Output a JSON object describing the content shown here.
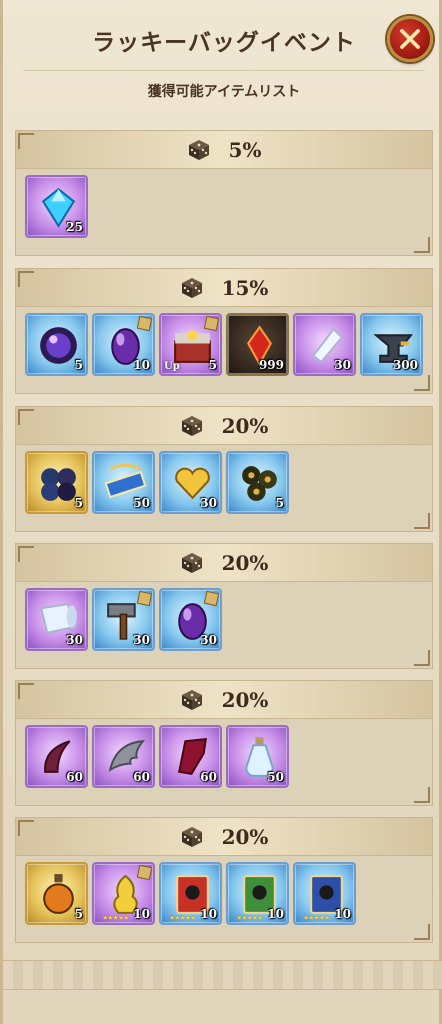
{
  "header": {
    "title": "ラッキーバッグイベント",
    "subtitle": "獲得可能アイテムリスト"
  },
  "sections": [
    {
      "rate": "5%",
      "items": [
        {
          "icon": "blue-gem-icon",
          "rarity": "purple",
          "qty": "25"
        }
      ]
    },
    {
      "rate": "15%",
      "items": [
        {
          "icon": "dark-orb-icon",
          "rarity": "blue",
          "qty": "5"
        },
        {
          "icon": "purple-egg-icon",
          "rarity": "blue",
          "qty": "10",
          "badge": true
        },
        {
          "icon": "treasure-chest-icon",
          "rarity": "purple",
          "qty": "5",
          "tag": "Up",
          "badge": true
        },
        {
          "icon": "red-crystal-icon",
          "rarity": "dark",
          "qty": "999"
        },
        {
          "icon": "crystal-shard-icon",
          "rarity": "purple",
          "qty": "30"
        },
        {
          "icon": "anvil-icon",
          "rarity": "blue",
          "qty": "300"
        }
      ]
    },
    {
      "rate": "20%",
      "items": [
        {
          "icon": "orb-cluster-icon",
          "rarity": "gold",
          "qty": "5"
        },
        {
          "icon": "ticket-icon",
          "rarity": "blue",
          "qty": "50"
        },
        {
          "icon": "golden-heart-icon",
          "rarity": "blue",
          "qty": "30"
        },
        {
          "icon": "seed-pods-icon",
          "rarity": "blue",
          "qty": "5"
        }
      ]
    },
    {
      "rate": "20%",
      "items": [
        {
          "icon": "cloth-roll-icon",
          "rarity": "purple",
          "qty": "30"
        },
        {
          "icon": "hammer-icon",
          "rarity": "blue",
          "qty": "30",
          "badge": true
        },
        {
          "icon": "purple-egg-icon",
          "rarity": "blue",
          "qty": "30",
          "badge": true
        }
      ]
    },
    {
      "rate": "20%",
      "items": [
        {
          "icon": "horn-icon",
          "rarity": "purple",
          "qty": "60"
        },
        {
          "icon": "wing-icon",
          "rarity": "purple",
          "qty": "60"
        },
        {
          "icon": "red-cloth-icon",
          "rarity": "purple",
          "qty": "60"
        },
        {
          "icon": "potion-bottle-icon",
          "rarity": "purple",
          "qty": "50"
        }
      ]
    },
    {
      "rate": "20%",
      "items": [
        {
          "icon": "orange-potion-icon",
          "rarity": "gold",
          "qty": "5"
        },
        {
          "icon": "golden-statue-icon",
          "rarity": "purple",
          "qty": "10",
          "stars": "★★★★★",
          "badge": true
        },
        {
          "icon": "red-card-icon",
          "rarity": "blue",
          "qty": "10",
          "stars": "★★★★★"
        },
        {
          "icon": "green-card-icon",
          "rarity": "blue",
          "qty": "10",
          "stars": "★★★★★"
        },
        {
          "icon": "blue-card-icon",
          "rarity": "blue",
          "qty": "10",
          "stars": "★★★★★"
        }
      ]
    }
  ]
}
